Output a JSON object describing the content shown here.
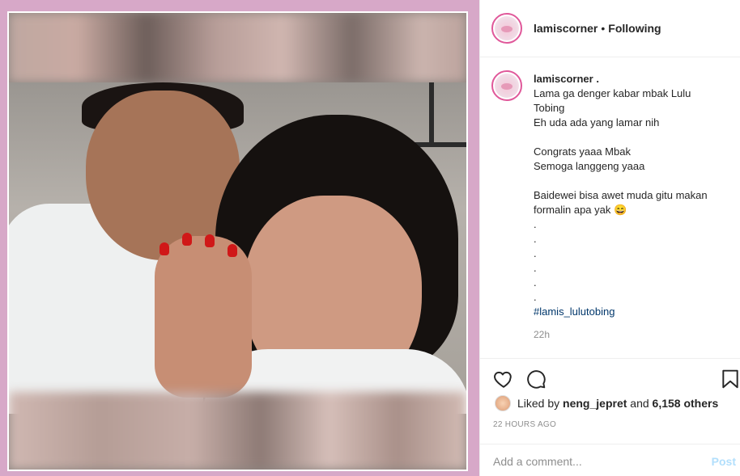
{
  "post": {
    "username": "lamiscorner",
    "separator": "•",
    "follow_status": "Following",
    "caption_username": "lamiscorner .",
    "caption_lines": [
      "Lama ga denger kabar mbak Lulu",
      "Tobing",
      "Eh uda ada yang lamar nih",
      "",
      "Congrats yaaa Mbak",
      "Semoga langgeng yaaa",
      "",
      "Baidewei bisa awet muda gitu makan",
      "formalin apa yak 😄",
      ".",
      ".",
      ".",
      ".",
      ".",
      "."
    ],
    "hashtag": "#lamis_lulutobing",
    "caption_time": "22h",
    "likes": {
      "prefix": "Liked by",
      "liker": "neng_jepret",
      "conjunction": "and",
      "others": "6,158 others"
    },
    "timestamp": "22 HOURS AGO",
    "comment_placeholder": "Add a comment...",
    "post_button": "Post"
  },
  "icons": {
    "like": "heart-icon",
    "comment": "comment-icon",
    "save": "bookmark-icon"
  },
  "colors": {
    "accent_pink": "#d6a6c6",
    "link_blue": "#00376b",
    "post_disabled": "#b2dffc",
    "story_ring": "#e0589a"
  }
}
